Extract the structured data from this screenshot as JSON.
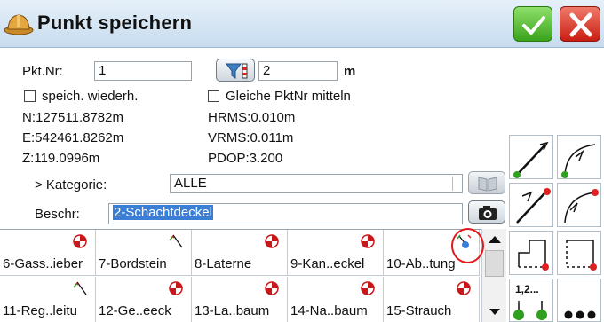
{
  "titlebar": {
    "icon": "hardhat-icon",
    "title": "Punkt speichern",
    "ok_icon": "checkmark-icon",
    "cancel_icon": "close-icon"
  },
  "form": {
    "pktnr_label": "Pkt.Nr:",
    "pktnr_value": "1",
    "height_value": "2",
    "height_unit": "m",
    "speich_label": "speich. wiederh.",
    "gleiche_label": "Gleiche PktNr mitteln",
    "n": "N:127511.8782m",
    "e": "E:542461.8262m",
    "z": "Z:119.0996m",
    "hrms": "HRMS:0.010m",
    "vrms": "VRMS:0.011m",
    "pdop": "PDOP:3.200",
    "kategorie_label": "> Kategorie:",
    "kategorie_value": "ALLE",
    "beschr_label": "Beschr:",
    "beschr_value": "2-Schachtdeckel"
  },
  "codes": [
    {
      "label": "6-Gass..ieber",
      "icon": "target-icon"
    },
    {
      "label": "7-Bordstein",
      "icon": "line-code-icon"
    },
    {
      "label": "8-Laterne",
      "icon": "target-icon"
    },
    {
      "label": "9-Kan..eckel",
      "icon": "target-icon"
    },
    {
      "label": "10-Ab..tung",
      "icon": "line-point-code-icon"
    },
    {
      "label": "11-Reg..leitu",
      "icon": "line-code-icon"
    },
    {
      "label": "12-Ge..eeck",
      "icon": "target-icon"
    },
    {
      "label": "13-La..baum",
      "icon": "target-icon"
    },
    {
      "label": "14-Na..baum",
      "icon": "target-icon"
    },
    {
      "label": "15-Strauch",
      "icon": "target-icon"
    }
  ],
  "side_tools": [
    "line-start-icon",
    "arc-start-icon",
    "line-end-icon",
    "arc-end-icon",
    "close-polygon-icon",
    "rectangle-icon",
    "numbered-points-icon",
    "more-icon"
  ],
  "side_tool_text": {
    "numbered": "1,2..."
  },
  "colors": {
    "accent": "#3a7fd5",
    "ok": "#3aa31c",
    "cancel": "#c81e12",
    "highlight": "#e3161b"
  }
}
